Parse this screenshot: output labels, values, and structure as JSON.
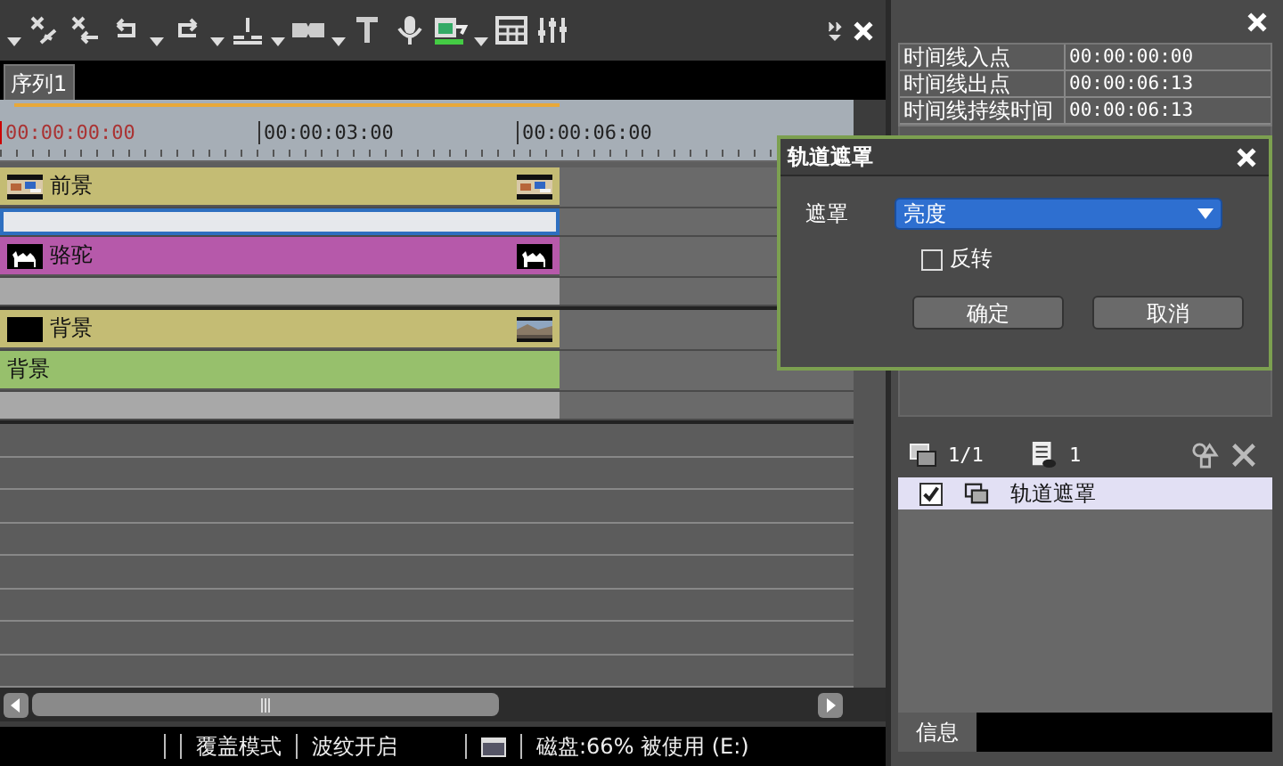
{
  "sequence_tabs": [
    {
      "label": "序列1",
      "selected": true
    }
  ],
  "ruler": {
    "timecodes": [
      "00:00:00:00",
      "00:00:03:00",
      "00:00:06:00"
    ]
  },
  "tracks": [
    {
      "kind": "clip",
      "label": "前景",
      "color": "#c4bc74",
      "thumbs": [
        {
          "kind": "scene"
        },
        {
          "kind": "scene"
        }
      ]
    },
    {
      "kind": "key",
      "selected": true
    },
    {
      "kind": "clip",
      "label": "骆驼",
      "color": "#b659aa",
      "thumbs": [
        {
          "kind": "camel"
        },
        {
          "kind": "camel"
        }
      ]
    },
    {
      "kind": "audio"
    },
    {
      "kind": "clip",
      "label": "背景",
      "color": "#c4bc74",
      "thumbs": [
        {
          "kind": "blank"
        },
        {
          "kind": "landscape"
        }
      ]
    },
    {
      "kind": "clip",
      "label": "背景",
      "color": "#97c06c"
    },
    {
      "kind": "audio"
    }
  ],
  "status_bar": {
    "mode": "覆盖模式",
    "ripple": "波纹开启",
    "disk": "磁盘:66% 被使用 (E:)"
  },
  "info_table": [
    {
      "label": "时间线入点",
      "value": "00:00:00:00"
    },
    {
      "label": "时间线出点",
      "value": "00:00:06:13"
    },
    {
      "label": "时间线持续时间",
      "value": "00:00:06:13"
    }
  ],
  "effects": {
    "layer_count": "1/1",
    "filter_count": "1",
    "items": [
      {
        "label": "轨道遮罩",
        "checked": true,
        "selected": true
      }
    ]
  },
  "bottom_tabs": [
    {
      "label": "信息",
      "selected": true
    }
  ],
  "dialog": {
    "title": "轨道遮罩",
    "field_label": "遮罩",
    "select_value": "亮度",
    "invert": {
      "label": "反转",
      "checked": false
    },
    "buttons": [
      "确定",
      "取消"
    ]
  }
}
